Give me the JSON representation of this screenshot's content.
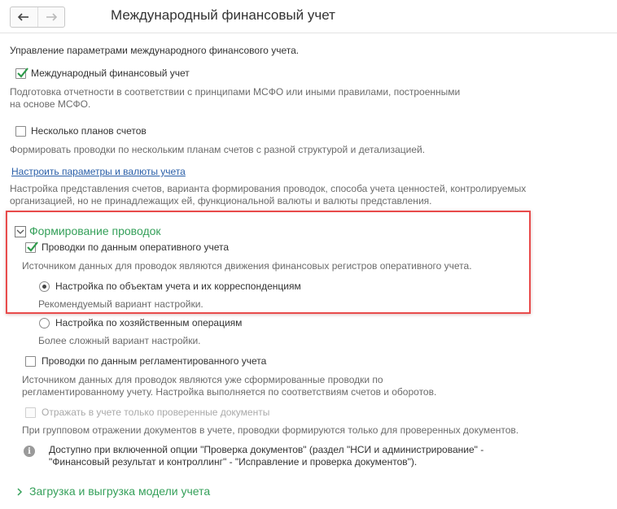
{
  "header": {
    "title": "Международный финансовый учет",
    "back_icon": "arrow-left-icon",
    "forward_icon": "arrow-right-icon"
  },
  "intro": "Управление параметрами международного финансового учета.",
  "ifrs": {
    "label": "Международный финансовый учет",
    "checked": true,
    "desc_line1": "Подготовка отчетности в соответствии с принципами МСФО или иными правилами, построенными",
    "desc_line2": "на основе МСФО."
  },
  "multiple_charts": {
    "label": "Несколько планов счетов",
    "checked": false,
    "desc": "Формировать проводки по нескольким планам счетов с разной структурой и детализацией."
  },
  "settings_link": {
    "label": "Настроить параметры и валюты учета",
    "desc_line1": "Настройка представления счетов, варианта формирования проводок, способа учета ценностей, контролируемых",
    "desc_line2": "организацией, но не принадлежащих ей, функциональной валюты и валюты представления."
  },
  "posting_group": {
    "title": "Формирование проводок",
    "expanded": true,
    "operational": {
      "label": "Проводки по данным оперативного учета",
      "checked": true,
      "desc": "Источником данных для проводок являются движения финансовых регистров оперативного учета."
    },
    "radio_accounts": {
      "label": "Настройка по объектам учета и их корреспонденциям",
      "selected": true,
      "desc": "Рекомендуемый вариант настройки."
    },
    "radio_operations": {
      "label": "Настройка по хозяйственным операциям",
      "selected": false,
      "desc": "Более сложный вариант настройки."
    },
    "regulated": {
      "label": "Проводки по данным регламентированного учета",
      "checked": false,
      "desc_line1": "Источником данных для проводок являются уже сформированные проводки по",
      "desc_line2": "регламентированному учету. Настройка выполняется по соответствиям счетов и оборотов."
    },
    "verified_only": {
      "label": "Отражать в учете только проверенные документы",
      "checked": false,
      "disabled": true,
      "desc": "При групповом отражении документов в учете, проводки формируются только для проверенных документов."
    },
    "info": {
      "icon": "info-icon",
      "line1": "Доступно при включенной опции \"Проверка документов\" (раздел \"НСИ и администрирование\" -",
      "line2": "\"Финансовый результат и контроллинг\" - \"Исправление и проверка документов\")."
    }
  },
  "model_group": {
    "title": "Загрузка и выгрузка модели учета",
    "expanded": false
  },
  "colors": {
    "group_title": "#35a05a",
    "link": "#2a5fa8",
    "highlight_border": "#e84b4b",
    "description": "#6b6b6b"
  }
}
